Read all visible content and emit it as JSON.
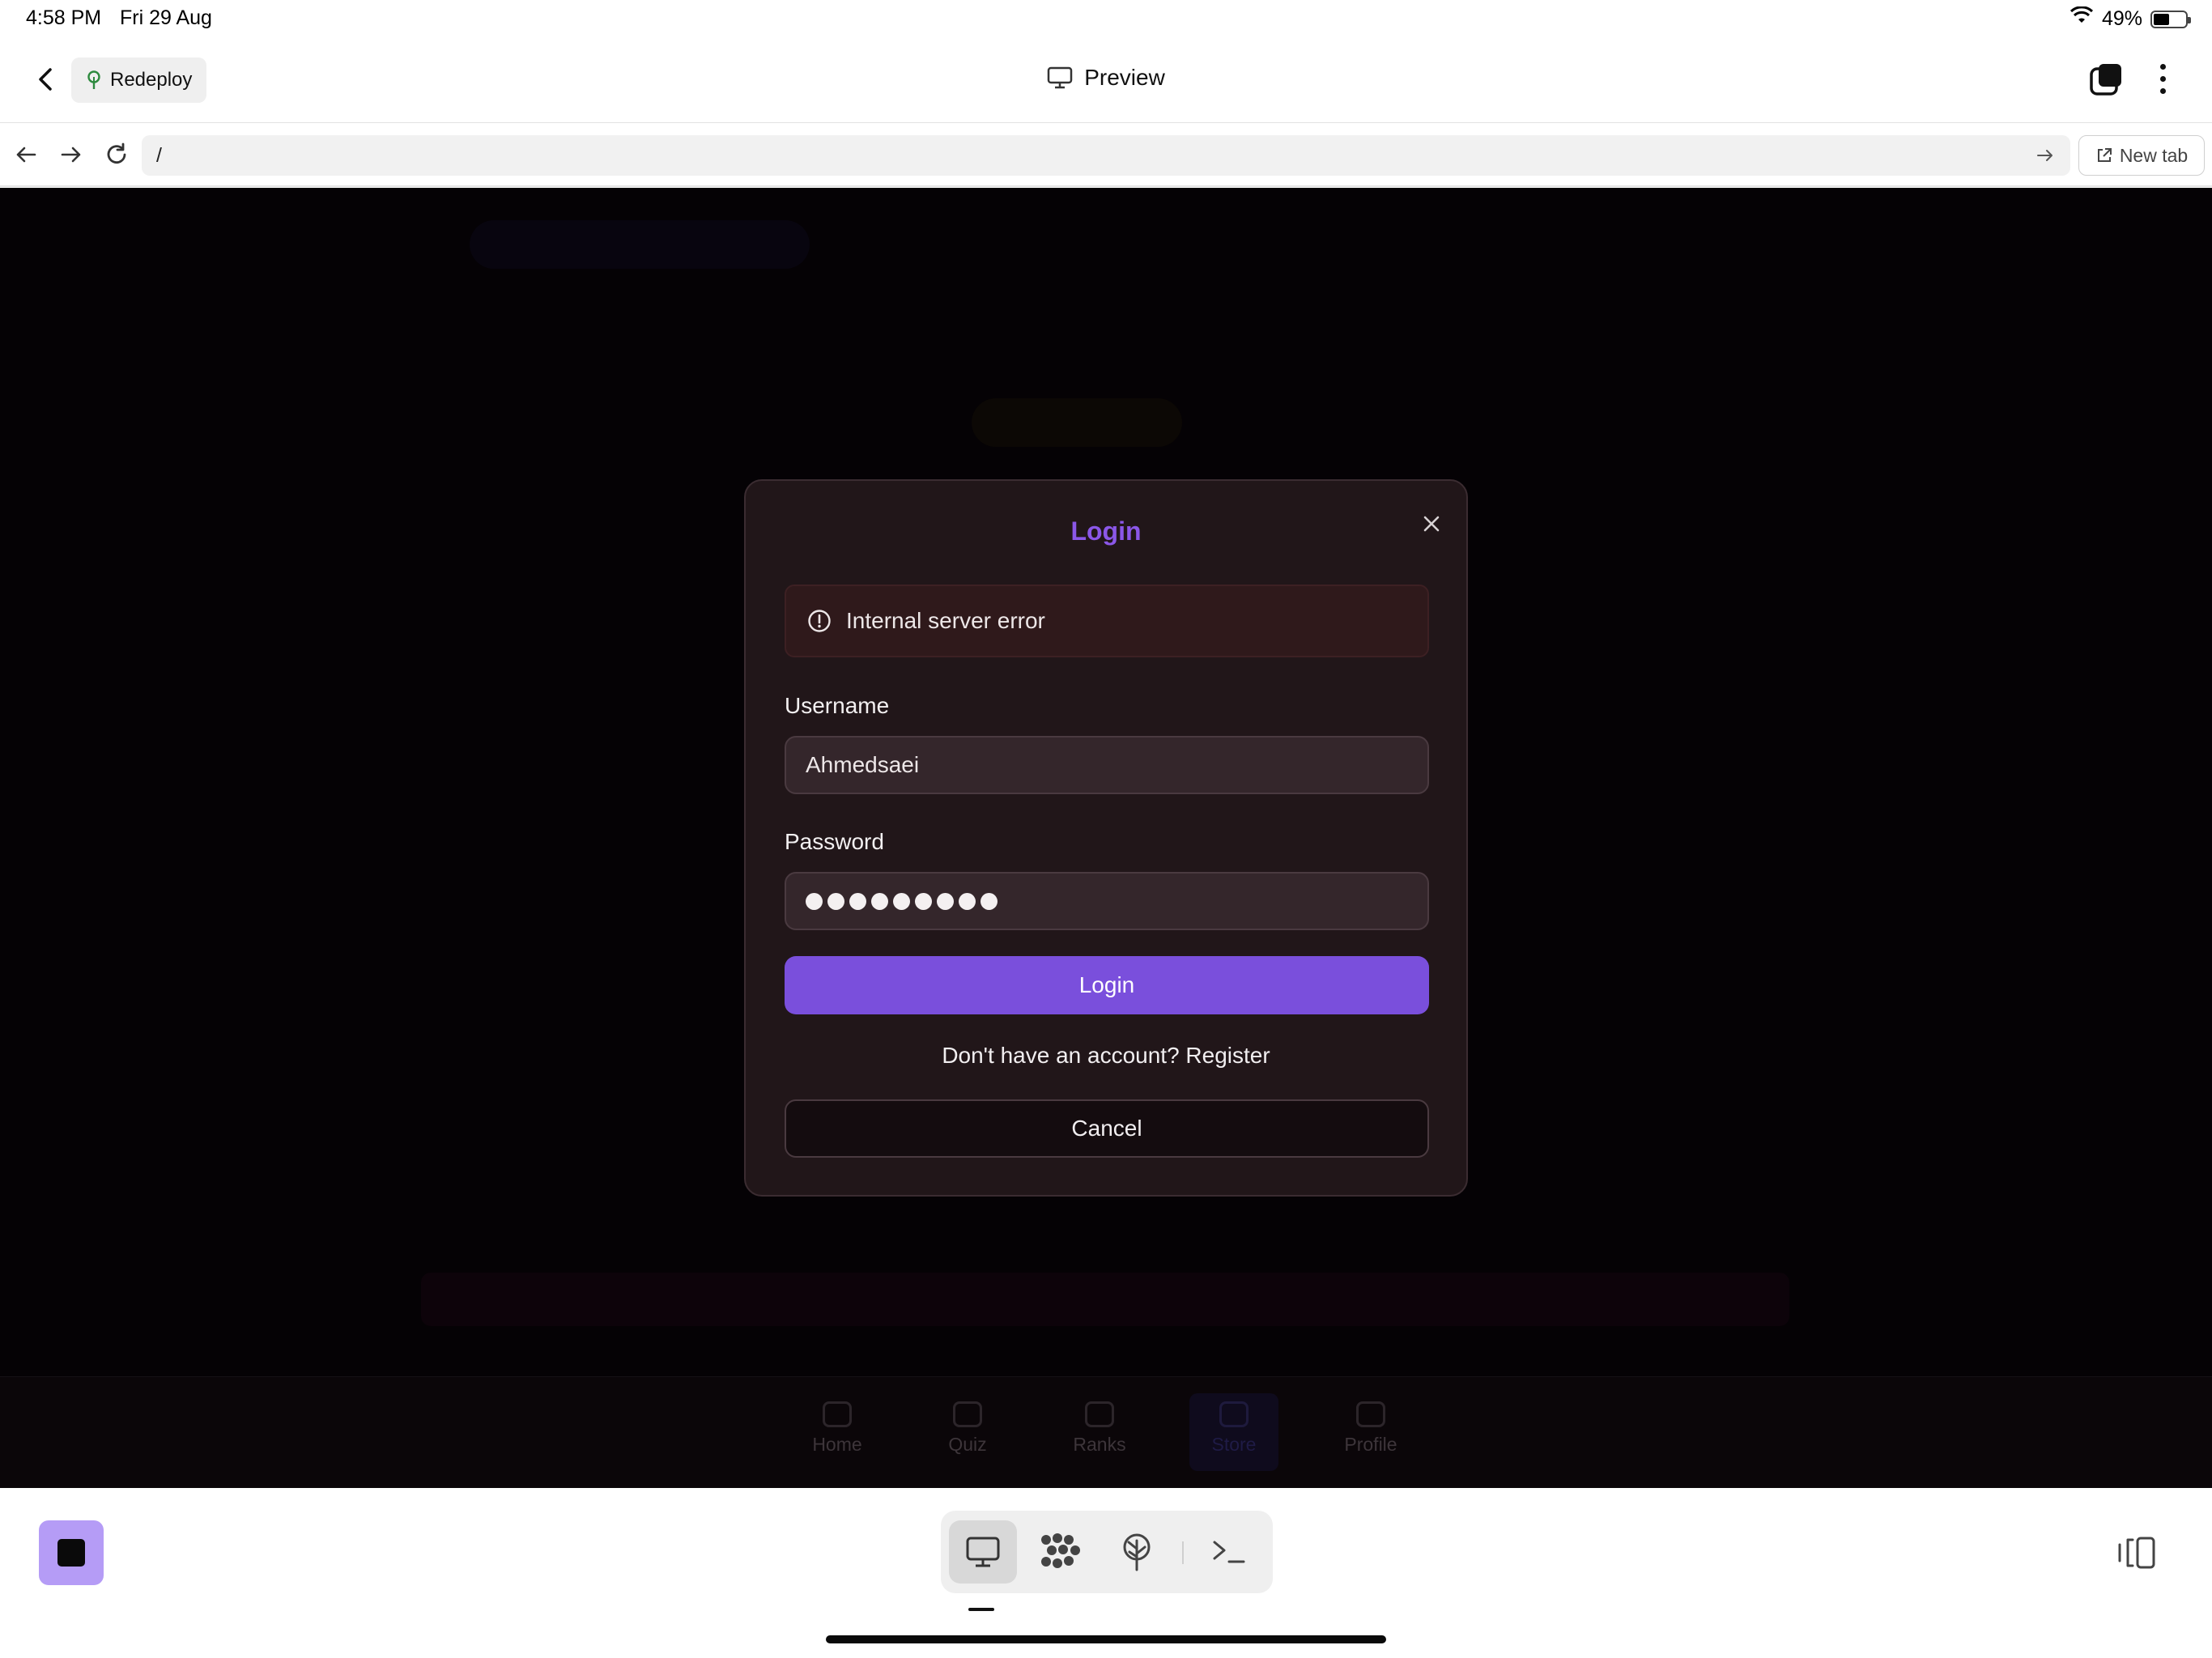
{
  "status_bar": {
    "time": "4:58 PM",
    "date": "Fri 29 Aug",
    "battery_text": "49%",
    "battery_level": 0.49
  },
  "top_nav": {
    "redeploy_label": "Redeploy",
    "title": "Preview"
  },
  "browser": {
    "url": "/",
    "new_tab_label": "New tab"
  },
  "modal": {
    "title": "Login",
    "error_message": "Internal server error",
    "username_label": "Username",
    "username_value": "Ahmedsaei",
    "password_label": "Password",
    "password_dot_count": 9,
    "login_button": "Login",
    "register_text": "Don't have an account? Register",
    "cancel_button": "Cancel"
  },
  "app_tabs": [
    {
      "label": "Home",
      "icon": "home-icon",
      "active": false
    },
    {
      "label": "Quiz",
      "icon": "play-icon",
      "active": false
    },
    {
      "label": "Ranks",
      "icon": "trophy-icon",
      "active": false
    },
    {
      "label": "Store",
      "icon": "coins-icon",
      "active": true
    },
    {
      "label": "Profile",
      "icon": "user-icon",
      "active": false
    }
  ],
  "toolbar": {
    "items": [
      {
        "icon": "monitor-icon",
        "active": true
      },
      {
        "icon": "cluster-icon",
        "active": false
      },
      {
        "icon": "deploy-tree-icon",
        "active": false
      },
      {
        "icon": "terminal-icon",
        "active": false
      }
    ]
  },
  "colors": {
    "accent_purple": "#7a4fdc",
    "title_purple": "#8b57e8",
    "modal_bg": "#211619",
    "error_bg": "#2f191b",
    "stop_button": "#b59cf6"
  }
}
